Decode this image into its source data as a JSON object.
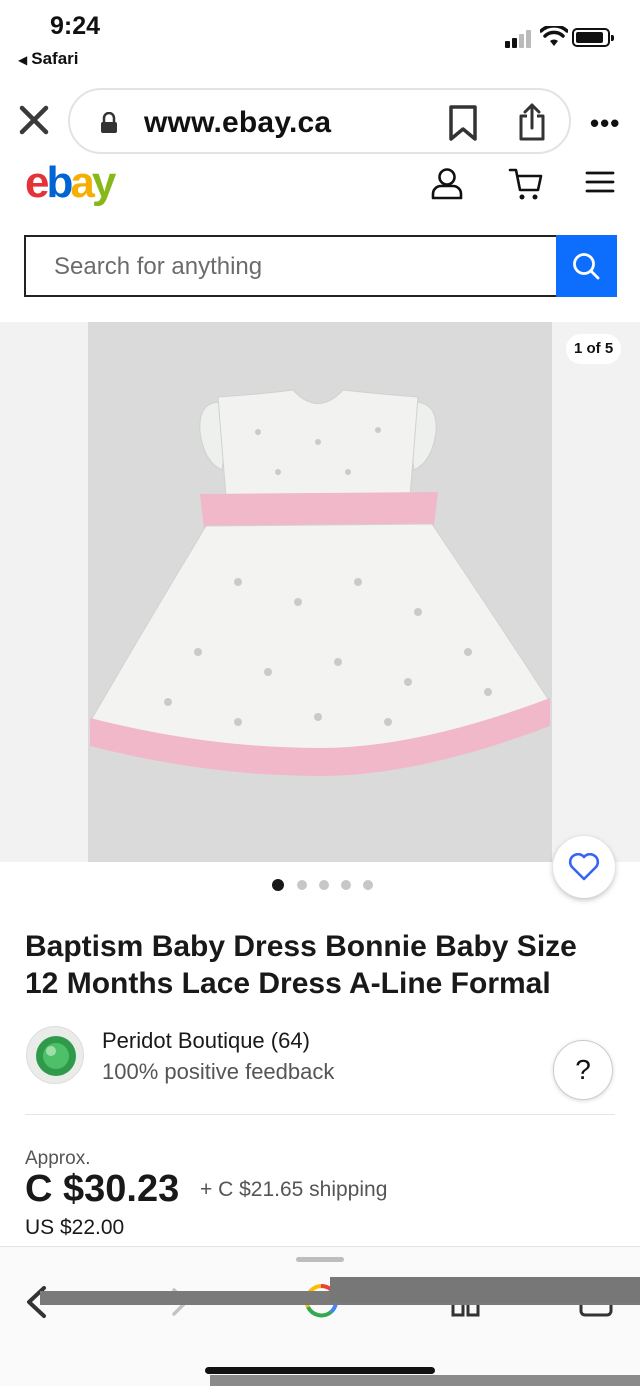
{
  "status_bar": {
    "time": "9:24",
    "back_app": "Safari",
    "signal_icon": "cellular-signal-icon",
    "wifi_icon": "wifi-icon",
    "battery_icon": "battery-icon"
  },
  "browser": {
    "url": "www.ebay.ca",
    "close_icon": "close-icon",
    "lock_icon": "lock-icon",
    "bookmark_icon": "bookmark-icon",
    "share_icon": "share-icon",
    "more_label": "•••"
  },
  "header": {
    "logo": {
      "e": "e",
      "b": "b",
      "a": "a",
      "y": "y"
    },
    "user_icon": "user-icon",
    "cart_icon": "cart-icon",
    "menu_icon": "hamburger-menu-icon"
  },
  "search": {
    "placeholder": "Search for anything",
    "button_icon": "search-icon"
  },
  "gallery": {
    "counter": "1 of 5",
    "total_images": 5,
    "active_index": 0,
    "watch_icon": "heart-icon"
  },
  "listing": {
    "title": "Baptism Baby Dress Bonnie Baby Size 12 Months Lace Dress A-Line Formal",
    "seller_name": "Peridot Boutique (64)",
    "seller_feedback": "100% positive feedback",
    "help_label": "?",
    "approx_label": "Approx.",
    "price": "C $30.23",
    "shipping": "+ C $21.65 shipping",
    "us_price": "US $22.00"
  },
  "toolbar": {
    "back_icon": "back-arrow-icon",
    "forward_icon": "forward-arrow-icon",
    "google_icon": "google-icon",
    "tabs_icon": "tabs-icon",
    "share_icon": "share-icon"
  },
  "colors": {
    "accent": "#0d6efd",
    "logo_red": "#e53238",
    "logo_blue": "#0064d2",
    "logo_yellow": "#f5af02",
    "logo_green": "#86b817",
    "dress_pink": "#f0b8c8"
  }
}
